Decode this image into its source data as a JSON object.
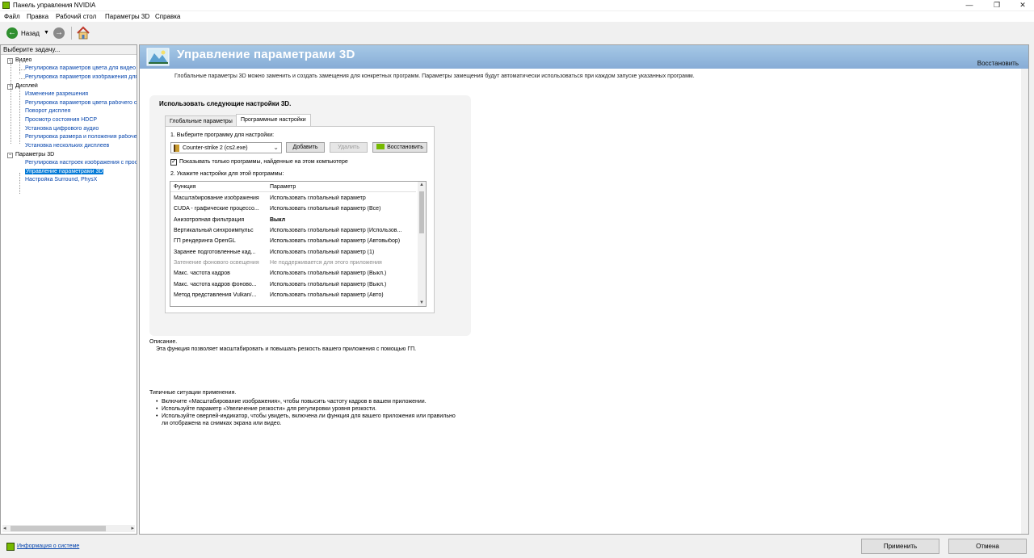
{
  "window": {
    "title": "Панель управления NVIDIA",
    "controls": {
      "minimize": "—",
      "maximize": "❐",
      "close": "✕"
    }
  },
  "menu": [
    "Файл",
    "Правка",
    "Рабочий стол",
    "Параметры 3D",
    "Справка"
  ],
  "toolbar": {
    "back_label": "Назад",
    "back_icon": "back-arrow-icon",
    "forward_icon": "forward-arrow-icon",
    "home_icon": "home-icon"
  },
  "sidebar": {
    "header": "Выберите задачу...",
    "categories": [
      {
        "label": "Видео",
        "toggle": "−",
        "items": [
          "Регулировка параметров цвета для видео",
          "Регулировка параметров изображения для видео"
        ]
      },
      {
        "label": "Дисплей",
        "toggle": "−",
        "items": [
          "Изменение разрешения",
          "Регулировка параметров цвета рабочего стола",
          "Поворот дисплея",
          "Просмотр состояния HDCP",
          "Установка цифрового аудио",
          "Регулировка размера и положения рабочего стола",
          "Установка нескольких дисплеев"
        ]
      },
      {
        "label": "Параметры 3D",
        "toggle": "−",
        "items": [
          "Регулировка настроек изображения с просмотром",
          "Управление параметрами 3D",
          "Настройка Surround, PhysX"
        ]
      }
    ],
    "selected_item": "Управление параметрами 3D"
  },
  "page": {
    "title": "Управление параметрами 3D",
    "restore_label": "Восстановить",
    "description": "Глобальные параметры 3D можно заменить и создать замещения для конкретных программ. Параметры замещения будут автоматически использоваться при каждом запуске указанных программ.",
    "panel_title": "Использовать следующие настройки 3D.",
    "tabs": [
      {
        "label": "Глобальные параметры",
        "active": false
      },
      {
        "label": "Программные настройки",
        "active": true
      }
    ],
    "step1_label": "1. Выберите программу для настройки:",
    "program_selected": "Counter-strike 2 (cs2.exe)",
    "buttons": {
      "add": "Добавить",
      "remove": "Удалить",
      "restore": "Восстановить"
    },
    "checkbox": {
      "label": "Показывать только программы, найденные на этом компьютере",
      "checked": true,
      "mark": "✓"
    },
    "step2_label": "2. Укажите настройки для этой программы:",
    "settings_table": {
      "columns": [
        "Функция",
        "Параметр"
      ],
      "rows": [
        {
          "feature": "Масштабирование изображения",
          "value": "Использовать глобальный параметр",
          "style": "normal"
        },
        {
          "feature": "CUDA - графические процессо...",
          "value": "Использовать глобальный параметр (Все)",
          "style": "normal"
        },
        {
          "feature": "Анизотропная фильтрация",
          "value": "Выкл",
          "style": "bold"
        },
        {
          "feature": "Вертикальный синхроимпульс",
          "value": "Использовать глобальный параметр (Использов...",
          "style": "normal"
        },
        {
          "feature": "ГП рендеринга OpenGL",
          "value": "Использовать глобальный параметр (Автовыбор)",
          "style": "normal"
        },
        {
          "feature": "Заранее подготовленные кад...",
          "value": "Использовать глобальный параметр (1)",
          "style": "normal"
        },
        {
          "feature": "Затенение фонового освещения",
          "value": "Не поддерживается для этого приложения",
          "style": "dim"
        },
        {
          "feature": "Макс. частота кадров",
          "value": "Использовать глобальный параметр (Выкл.)",
          "style": "normal"
        },
        {
          "feature": "Макс. частота кадров фоново...",
          "value": "Использовать глобальный параметр (Выкл.)",
          "style": "normal"
        },
        {
          "feature": "Метод представления Vulkan/...",
          "value": "Использовать глобальный параметр (Авто)",
          "style": "normal"
        }
      ]
    },
    "description_label": "Описание.",
    "description_text": "Эта функция позволяет масштабировать и повышать резкость вашего приложения с помощью ГП.",
    "typical_label": "Типичные ситуации применения.",
    "typical_bullets": [
      "Включите «Масштабирование изображения», чтобы повысить частоту кадров в вашем приложении.",
      "Используйте параметр «Увеличение резкости» для регулировки уровня резкости.",
      "Используйте оверлей-индикатор, чтобы увидеть, включена ли функция для вашего приложения или правильно ли отображена на снимках экрана или видео."
    ]
  },
  "footer": {
    "system_info": "Информация о системе",
    "apply": "Применить",
    "cancel": "Отмена"
  },
  "colors": {
    "nvidia_green": "#76b900",
    "header_blue": "#86acd6",
    "link_blue": "#0645ad",
    "selection_blue": "#0078d7"
  }
}
